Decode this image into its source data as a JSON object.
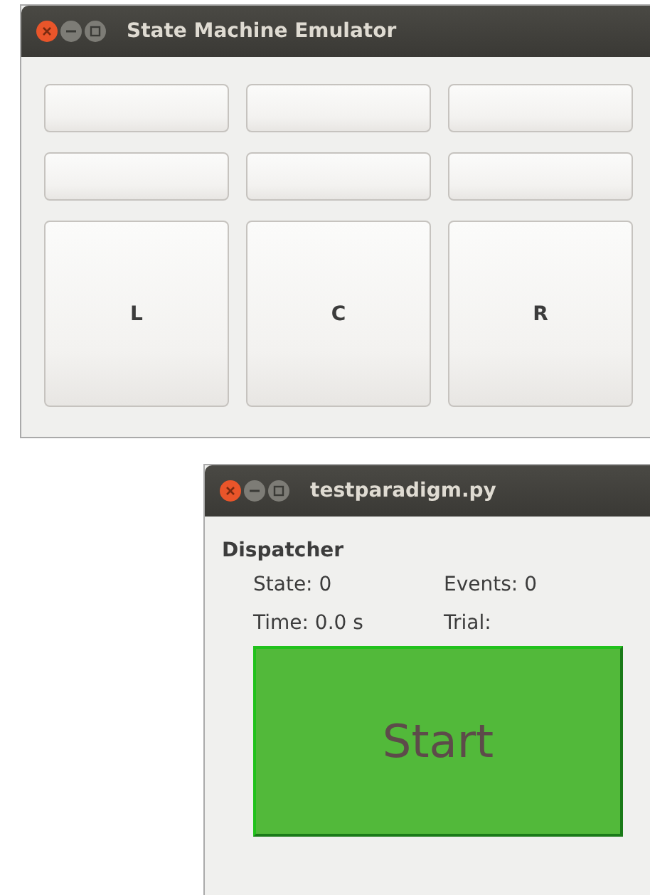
{
  "windows": [
    {
      "kind": "emulator",
      "title": "State Machine Emulator",
      "button_rows": [
        {
          "kind": "small",
          "buttons": [
            {
              "kind": "blank"
            },
            {
              "kind": "blank"
            },
            {
              "kind": "blank"
            }
          ]
        },
        {
          "kind": "small",
          "buttons": [
            {
              "kind": "blank"
            },
            {
              "kind": "blank"
            },
            {
              "kind": "blank"
            }
          ]
        },
        {
          "kind": "large",
          "buttons": [
            {
              "kind": "labeled",
              "label": "L"
            },
            {
              "kind": "labeled",
              "label": "C"
            },
            {
              "kind": "labeled",
              "label": "R"
            }
          ]
        }
      ]
    },
    {
      "kind": "dispatcher",
      "title": "testparadigm.py",
      "heading": "Dispatcher",
      "fields": [
        "State: 0",
        "Events: 0",
        "Time: 0.0 s",
        "Trial:"
      ],
      "start_button": "Start"
    }
  ]
}
